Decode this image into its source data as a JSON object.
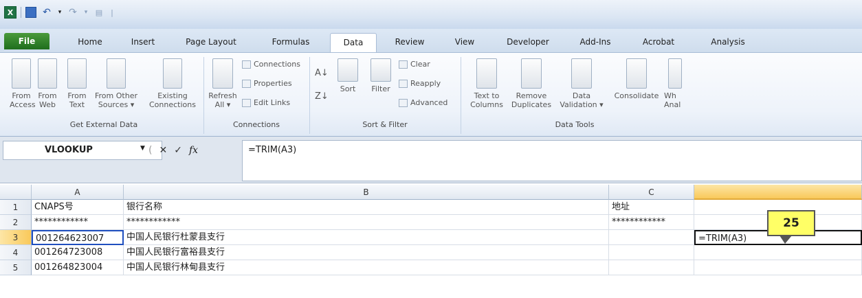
{
  "qat": {
    "undo_arrow": "▾",
    "sep": "|"
  },
  "tabs": [
    "File",
    "Home",
    "Insert",
    "Page Layout",
    "Formulas",
    "Data",
    "Review",
    "View",
    "Developer",
    "Add-Ins",
    "Acrobat",
    "Analysis"
  ],
  "ribbon": {
    "get_external": {
      "from_access": "From\nAccess",
      "from_web": "From\nWeb",
      "from_text": "From\nText",
      "from_other": "From Other\nSources ▾",
      "existing": "Existing\nConnections",
      "label": "Get External Data"
    },
    "connections": {
      "refresh": "Refresh\nAll ▾",
      "connections": "Connections",
      "properties": "Properties",
      "edit_links": "Edit Links",
      "label": "Connections"
    },
    "sort_filter": {
      "sort": "Sort",
      "filter": "Filter",
      "clear": "Clear",
      "reapply": "Reapply",
      "advanced": "Advanced",
      "label": "Sort & Filter"
    },
    "data_tools": {
      "text_to_columns": "Text to\nColumns",
      "remove_duplicates": "Remove\nDuplicates",
      "data_validation": "Data\nValidation ▾",
      "consolidate": "Consolidate",
      "what_if": "Wh\nAnal",
      "label": "Data Tools"
    }
  },
  "formula_bar": {
    "name_box": "VLOOKUP",
    "formula": "=TRIM(A3)"
  },
  "grid": {
    "columns": [
      "A",
      "B",
      "C",
      ""
    ],
    "rows": [
      {
        "n": "1",
        "a": "CNAPS号",
        "b": "银行名称",
        "c": "地址",
        "d": ""
      },
      {
        "n": "2",
        "a": "************",
        "b": "************",
        "c": "************",
        "d": ""
      },
      {
        "n": "3",
        "a": "001264623007",
        "b": "中国人民银行杜蒙县支行",
        "c": "",
        "d": "=TRIM(A3)"
      },
      {
        "n": "4",
        "a": "001264723008",
        "b": "中国人民银行富裕县支行",
        "c": "",
        "d": ""
      },
      {
        "n": "5",
        "a": "001264823004",
        "b": "中国人民银行林甸县支行",
        "c": "",
        "d": ""
      }
    ]
  },
  "callout": "25"
}
